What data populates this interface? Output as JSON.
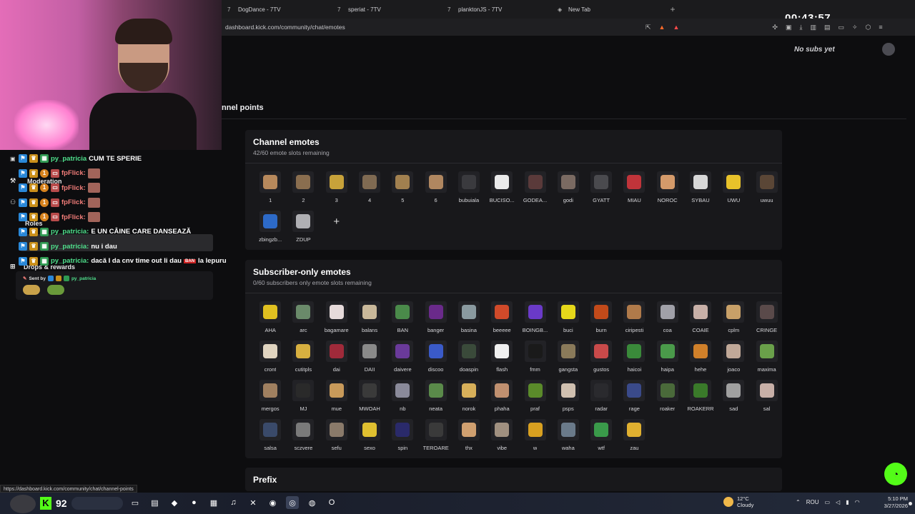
{
  "browser": {
    "tabs": [
      {
        "label": "DogDance - 7TV",
        "icon": "7tv-icon"
      },
      {
        "label": "speriat - 7TV",
        "icon": "7tv-icon"
      },
      {
        "label": "planktonJS - 7TV",
        "icon": "7tv-icon"
      },
      {
        "label": "New Tab",
        "icon": "shield-icon"
      }
    ],
    "new_tab": "+",
    "url": "dashboard.kick.com/community/chat/emotes",
    "status_url": "https://dashboard.kick.com/community/chat/channel-points",
    "timer": "00:43:57"
  },
  "sidebar": {
    "items": [
      {
        "label": "Moderation",
        "icon": "wrench-icon"
      },
      {
        "label": "Roles",
        "icon": "people-icon"
      },
      {
        "label": "Drops & rewards",
        "icon": "gift-icon"
      }
    ]
  },
  "chat": {
    "messages": [
      {
        "user": "py_patricia",
        "text": "CUM TE SPERIE",
        "color": "#4fe08c"
      },
      {
        "user": "fpFlick:",
        "text": "",
        "color": "#f07c78",
        "emote": true
      },
      {
        "user": "fpFlick:",
        "text": "",
        "color": "#f07c78",
        "emote": true
      },
      {
        "user": "fpFlick:",
        "text": "",
        "color": "#f07c78",
        "emote": true
      },
      {
        "user": "fpFlick:",
        "text": "",
        "color": "#f07c78",
        "emote": true
      },
      {
        "user": "py_patricia:",
        "text": "E UN CÂINE CARE DANSEAZĂ",
        "color": "#4fe08c"
      },
      {
        "user": "py_patricia:",
        "text": "nu i dau",
        "color": "#4fe08c"
      },
      {
        "user": "py_patricia:",
        "text": "dacă I da cnv time out Ii dau",
        "text2": "la lepuru",
        "color": "#4fe08c",
        "ban": "BAN"
      }
    ],
    "sent_by_label": "Sent by",
    "sent_by_user": "py_patricia"
  },
  "header": {
    "no_subs": "No subs yet",
    "tab_label": "nnel points"
  },
  "channel_emotes": {
    "title": "Channel emotes",
    "subtitle": "42/60 emote slots remaining",
    "add_label": "+",
    "items": [
      {
        "label": "1",
        "color": "#b7895c"
      },
      {
        "label": "2",
        "color": "#8a6e4f"
      },
      {
        "label": "3",
        "color": "#c7a23a"
      },
      {
        "label": "4",
        "color": "#7f6a52"
      },
      {
        "label": "5",
        "color": "#a1804f"
      },
      {
        "label": "6",
        "color": "#b08760"
      },
      {
        "label": "bubuiala",
        "color": "#3a3a3e"
      },
      {
        "label": "BUCISO...",
        "color": "#eaeaea"
      },
      {
        "label": "GODEA...",
        "color": "#5a3a3a"
      },
      {
        "label": "godi",
        "color": "#7a6a62"
      },
      {
        "label": "GYATT",
        "color": "#4a4a4e"
      },
      {
        "label": "MIAU",
        "color": "#c0343a"
      },
      {
        "label": "NOROC",
        "color": "#d49a6a"
      },
      {
        "label": "SYBAU",
        "color": "#d8d8d8"
      },
      {
        "label": "UWU",
        "color": "#e8c22a"
      },
      {
        "label": "uwuu",
        "color": "#5a4636"
      },
      {
        "label": "zbingzb...",
        "color": "#2d6ac8"
      },
      {
        "label": "ZDUP",
        "color": "#b0b0b4"
      }
    ]
  },
  "subscriber_emotes": {
    "title": "Subscriber-only emotes",
    "subtitle": "0/60 subscribers only emote slots remaining",
    "items": [
      {
        "label": "AHA",
        "color": "#e0c020"
      },
      {
        "label": "arc",
        "color": "#6a8a6a"
      },
      {
        "label": "bagamare",
        "color": "#e6dada"
      },
      {
        "label": "balans",
        "color": "#c9b89a"
      },
      {
        "label": "BAN",
        "color": "#4a8a4a"
      },
      {
        "label": "banger",
        "color": "#6a2a8a"
      },
      {
        "label": "basina",
        "color": "#8a9aa0"
      },
      {
        "label": "beeeee",
        "color": "#d04a2a"
      },
      {
        "label": "BOINGB...",
        "color": "#6a3ac8"
      },
      {
        "label": "buci",
        "color": "#e6d81a"
      },
      {
        "label": "burn",
        "color": "#c24a1a"
      },
      {
        "label": "ciripesti",
        "color": "#b07a4a"
      },
      {
        "label": "coa",
        "color": "#a0a0a8"
      },
      {
        "label": "COAIE",
        "color": "#c8b0a8"
      },
      {
        "label": "cplm",
        "color": "#c8a068"
      },
      {
        "label": "CRINGE",
        "color": "#5a4a4a"
      },
      {
        "label": "cront",
        "color": "#e0d4c0"
      },
      {
        "label": "cutitpls",
        "color": "#d8b040"
      },
      {
        "label": "dai",
        "color": "#a02a3a"
      },
      {
        "label": "DAII",
        "color": "#8a8a8a"
      },
      {
        "label": "daivere",
        "color": "#6a3a9a"
      },
      {
        "label": "discoo",
        "color": "#3a5ac8"
      },
      {
        "label": "doaspin",
        "color": "#3a4a3a"
      },
      {
        "label": "flash",
        "color": "#f0f0f0"
      },
      {
        "label": "fmm",
        "color": "#1a1a1a"
      },
      {
        "label": "gangsta",
        "color": "#8a7a5a"
      },
      {
        "label": "gustos",
        "color": "#c84a4a"
      },
      {
        "label": "haicoi",
        "color": "#3a8a3a"
      },
      {
        "label": "haipa",
        "color": "#4a9a4a"
      },
      {
        "label": "hehe",
        "color": "#d0802a"
      },
      {
        "label": "joaco",
        "color": "#c0a898"
      },
      {
        "label": "maxima",
        "color": "#6aa04a"
      },
      {
        "label": "mergos",
        "color": "#a08060"
      },
      {
        "label": "MJ",
        "color": "#2a2a2a"
      },
      {
        "label": "mue",
        "color": "#c89a5a"
      },
      {
        "label": "MWOAH",
        "color": "#3a3a3a"
      },
      {
        "label": "nb",
        "color": "#8a8a9a"
      },
      {
        "label": "neata",
        "color": "#5a8a4a"
      },
      {
        "label": "norok",
        "color": "#d8b05a"
      },
      {
        "label": "phaha",
        "color": "#c09070"
      },
      {
        "label": "praf",
        "color": "#5a8a2a"
      },
      {
        "label": "psps",
        "color": "#d0c0b0"
      },
      {
        "label": "radar",
        "color": "#2a2a2e"
      },
      {
        "label": "rage",
        "color": "#3a4a8a"
      },
      {
        "label": "roaker",
        "color": "#4a6a3a"
      },
      {
        "label": "ROAKERR",
        "color": "#3a7a2a"
      },
      {
        "label": "sad",
        "color": "#a0a0a0"
      },
      {
        "label": "sal",
        "color": "#c8b0a8"
      },
      {
        "label": "salsa",
        "color": "#3a4a6a"
      },
      {
        "label": "sczvere",
        "color": "#7a7a7a"
      },
      {
        "label": "sefu",
        "color": "#8a7a6a"
      },
      {
        "label": "sexo",
        "color": "#e0c030"
      },
      {
        "label": "spin",
        "color": "#2a2a6a"
      },
      {
        "label": "TEROARE",
        "color": "#3a3a3a"
      },
      {
        "label": "thx",
        "color": "#d0a070"
      },
      {
        "label": "vibe",
        "color": "#a09080"
      },
      {
        "label": "w",
        "color": "#d8a020"
      },
      {
        "label": "waha",
        "color": "#6a7a8a"
      },
      {
        "label": "wtf",
        "color": "#3a9a4a"
      },
      {
        "label": "zau",
        "color": "#e0b030"
      }
    ]
  },
  "prefix": {
    "title": "Prefix"
  },
  "taskbar": {
    "viewer_count": "92",
    "kick_letter": "K",
    "apps": [
      {
        "icon": "taskview-icon",
        "glyph": "▭"
      },
      {
        "icon": "folder-icon",
        "glyph": "▤"
      },
      {
        "icon": "brave-icon",
        "glyph": "◆"
      },
      {
        "icon": "obs-icon",
        "glyph": "●"
      },
      {
        "icon": "store-icon",
        "glyph": "▦"
      },
      {
        "icon": "spotify-icon",
        "glyph": "♫"
      },
      {
        "icon": "xbox-icon",
        "glyph": "✕"
      },
      {
        "icon": "discord-icon",
        "glyph": "◉"
      },
      {
        "icon": "steam-icon",
        "glyph": "◎"
      },
      {
        "icon": "chrome-icon",
        "glyph": "◍"
      },
      {
        "icon": "opera-icon",
        "glyph": "O"
      }
    ],
    "weather_temp": "12°C",
    "weather_desc": "Cloudy",
    "lang": "ROU",
    "time": "5:10 PM",
    "date": "3/27/2026"
  }
}
